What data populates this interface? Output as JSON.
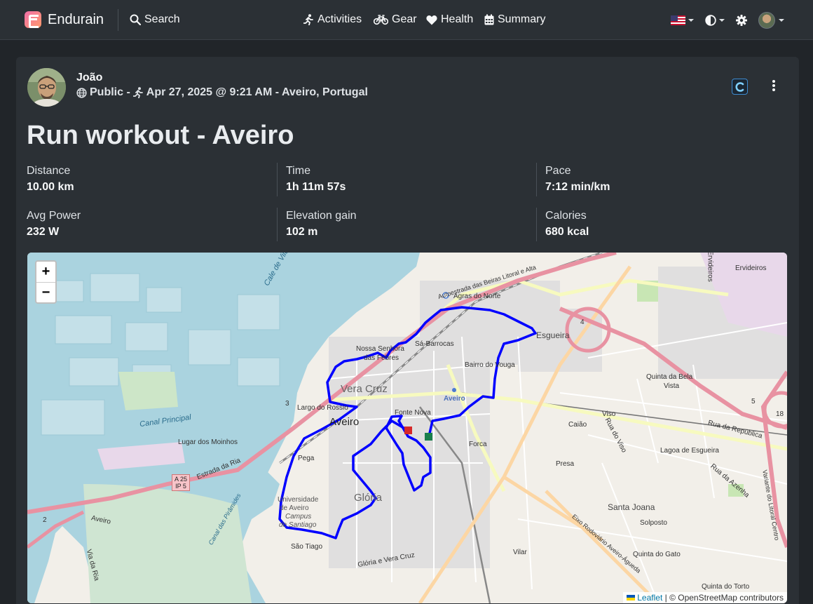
{
  "navbar": {
    "brand": "Endurain",
    "search": "Search",
    "links": {
      "activities": "Activities",
      "gear": "Gear",
      "health": "Health",
      "summary": "Summary"
    }
  },
  "activity": {
    "user": "João",
    "visibility": "Public -",
    "datetime": "Apr 27, 2025 @ 9:21 AM - Aveiro, Portugal",
    "title": "Run workout - Aveiro",
    "stats": [
      {
        "label": "Distance",
        "value": "10.00 km"
      },
      {
        "label": "Time",
        "value": "1h 11m 57s"
      },
      {
        "label": "Pace",
        "value": "7:12 min/km"
      },
      {
        "label": "Avg Power",
        "value": "232 W"
      },
      {
        "label": "Elevation gain",
        "value": "102 m"
      },
      {
        "label": "Calories",
        "value": "680 kcal"
      }
    ]
  },
  "map": {
    "zoom_in": "+",
    "zoom_out": "−",
    "attribution_leaflet": "Leaflet",
    "attribution_rest": "| © OpenStreetMap contributors",
    "labels": {
      "aveiro": "Aveiro",
      "vera_cruz": "Vera Cruz",
      "gloria": "Glória",
      "esgueira": "Esgueira",
      "santa_joana": "Santa Joana",
      "agras_do_norte": "Agras do Norte",
      "sa_barrocas": "Sá-Barrocas",
      "nossa_senhora": "Nossa Senhora",
      "das_febres": "das Febres",
      "bairro_do_vouga": "Bairro do Vouga",
      "fonte_nova": "Fonte Nova",
      "largo_do_rossio": "Largo do Rossio",
      "aveiro_station": "Aveiro",
      "forca": "Forca",
      "caiao": "Caião",
      "viso": "Viso",
      "presa": "Presa",
      "quinta_da_bela_vista": "Quinta da Bela",
      "quinta_da_bela_vista2": "Vista",
      "lagoa_de_esgueira": "Lagoa de Esgueira",
      "rua_da_republica": "Rua da República",
      "rua_da_azenha": "Rua da Azenha",
      "rua_do_viso": "Rua do Viso",
      "erdivieros": "Ervideiros",
      "ervideiros_vert": "Ervideiros",
      "solposto": "Solposto",
      "quinta_do_gato": "Quinta do Gato",
      "vilar": "Vilar",
      "quinta_do_torto": "Quinta do Torto",
      "lugar_dos_moinhos": "Lugar dos Moinhos",
      "canal_principal": "Canal Principal",
      "canal_das_piramides": "Canal das Pirâmides",
      "pega": "Pega",
      "sao_tiago": "São Tiago",
      "universidade": "Universidade",
      "de_aveiro": "de Aveiro",
      "campus": "Campus",
      "de_santiago": "de Santiago",
      "vera_cruz_small": "Vera Cruz",
      "gloria_e_vera_cruz": "Glória e Vera Cruz",
      "estrada_da_ria": "Estrada da Ria",
      "autoestrada": "Autoestrada das Beiras Litoral e Alta",
      "eixo_rodoviario": "Eixo Rodoviário Aveiro-Águeda",
      "variante": "Variante do Litoral Centro",
      "via_da_ria": "Via da Ria",
      "cale_de_vila": "Cale de Vila",
      "aveiro_road": "Aveiro",
      "a25": "A 25",
      "ip5": "IP 5",
      "n18": "18",
      "n4": "4",
      "n5": "5",
      "n3": "3",
      "n2": "2"
    },
    "route_color": "#0000ff",
    "start_color": "#1a7f4b",
    "end_color": "#d62828"
  },
  "colors": {
    "navbar_bg": "#2b3035",
    "page_bg": "#212529",
    "card_bg": "#2b3035",
    "water": "#aad3df",
    "land": "#f2efe9"
  }
}
